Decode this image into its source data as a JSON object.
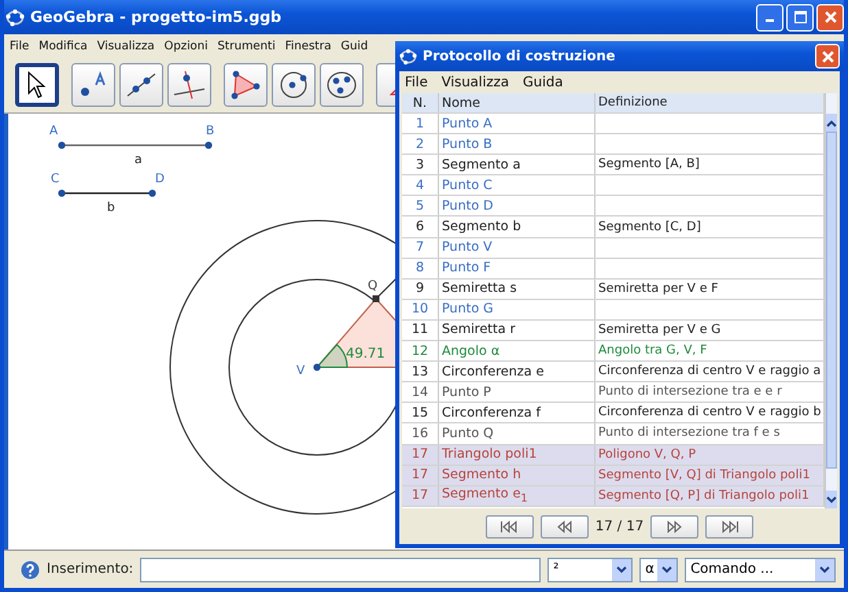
{
  "window": {
    "title": "GeoGebra - progetto-im5.ggb"
  },
  "menu": [
    "File",
    "Modifica",
    "Visualizza",
    "Opzioni",
    "Strumenti",
    "Finestra",
    "Guid"
  ],
  "toolbar": [
    {
      "kind": "move",
      "selected": true
    },
    {
      "kind": "point",
      "selected": false
    },
    {
      "kind": "segment",
      "selected": false
    },
    {
      "kind": "perpendicular",
      "selected": false
    },
    {
      "kind": "polygon",
      "selected": false
    },
    {
      "kind": "circle",
      "selected": false
    },
    {
      "kind": "conic",
      "selected": false
    },
    {
      "kind": "angle",
      "selected": false
    }
  ],
  "canvas": {
    "points": [
      {
        "label": "A"
      },
      {
        "label": "B"
      },
      {
        "label": "C"
      },
      {
        "label": "D"
      },
      {
        "label": "V"
      },
      {
        "label": "Q"
      }
    ],
    "segments": [
      {
        "label": "a"
      },
      {
        "label": "b"
      }
    ],
    "angle_label": "49.71"
  },
  "dialog": {
    "title": "Protocollo di costruzione",
    "menu": [
      "File",
      "Visualizza",
      "Guida"
    ],
    "columns": [
      "N.",
      "Nome",
      "Definizione"
    ],
    "rows": [
      {
        "n": "1",
        "name": "Punto A",
        "definition": "",
        "color": "#3a6fc4",
        "selected": false
      },
      {
        "n": "2",
        "name": "Punto B",
        "definition": "",
        "color": "#3a6fc4",
        "selected": false
      },
      {
        "n": "3",
        "name": "Segmento a",
        "definition": "Segmento [A, B]",
        "color": "#222222",
        "selected": false
      },
      {
        "n": "4",
        "name": "Punto C",
        "definition": "",
        "color": "#3a6fc4",
        "selected": false
      },
      {
        "n": "5",
        "name": "Punto D",
        "definition": "",
        "color": "#3a6fc4",
        "selected": false
      },
      {
        "n": "6",
        "name": "Segmento b",
        "definition": "Segmento [C, D]",
        "color": "#222222",
        "selected": false
      },
      {
        "n": "7",
        "name": "Punto V",
        "definition": "",
        "color": "#3a6fc4",
        "selected": false
      },
      {
        "n": "8",
        "name": "Punto F",
        "definition": "",
        "color": "#3a6fc4",
        "selected": false
      },
      {
        "n": "9",
        "name": "Semiretta s",
        "definition": "Semiretta per V e F",
        "color": "#222222",
        "selected": false
      },
      {
        "n": "10",
        "name": "Punto G",
        "definition": "",
        "color": "#3a6fc4",
        "selected": false
      },
      {
        "n": "11",
        "name": "Semiretta r",
        "definition": "Semiretta per V e G",
        "color": "#222222",
        "selected": false
      },
      {
        "n": "12",
        "name": "Angolo α",
        "definition": "Angolo tra G, V, F",
        "color": "#1f8a3c",
        "selected": false
      },
      {
        "n": "13",
        "name": "Circonferenza e",
        "definition": "Circonferenza di centro V e raggio a",
        "color": "#222222",
        "selected": false
      },
      {
        "n": "14",
        "name": "Punto P",
        "definition": "Punto di intersezione tra e e r",
        "color": "#555555",
        "selected": false
      },
      {
        "n": "15",
        "name": "Circonferenza f",
        "definition": "Circonferenza di centro V e raggio b",
        "color": "#222222",
        "selected": false
      },
      {
        "n": "16",
        "name": "Punto Q",
        "definition": "Punto di intersezione tra f e s",
        "color": "#555555",
        "selected": false
      },
      {
        "n": "17",
        "name": "Triangolo poli1",
        "definition": "Poligono V, Q, P",
        "color": "#b8433a",
        "selected": true
      },
      {
        "n": "17",
        "name": "Segmento h",
        "definition": "Segmento [V, Q] di Triangolo poli1",
        "color": "#b8433a",
        "selected": true
      },
      {
        "n": "17",
        "name": "Segmento e$_{1}$",
        "definition": "Segmento [Q, P] di Triangolo poli1",
        "color": "#b8433a",
        "selected": true
      }
    ],
    "position": "17 / 17"
  },
  "input_bar": {
    "label": "Inserimento:",
    "symbols": "²",
    "greek": "α",
    "command": "Comando ..."
  }
}
